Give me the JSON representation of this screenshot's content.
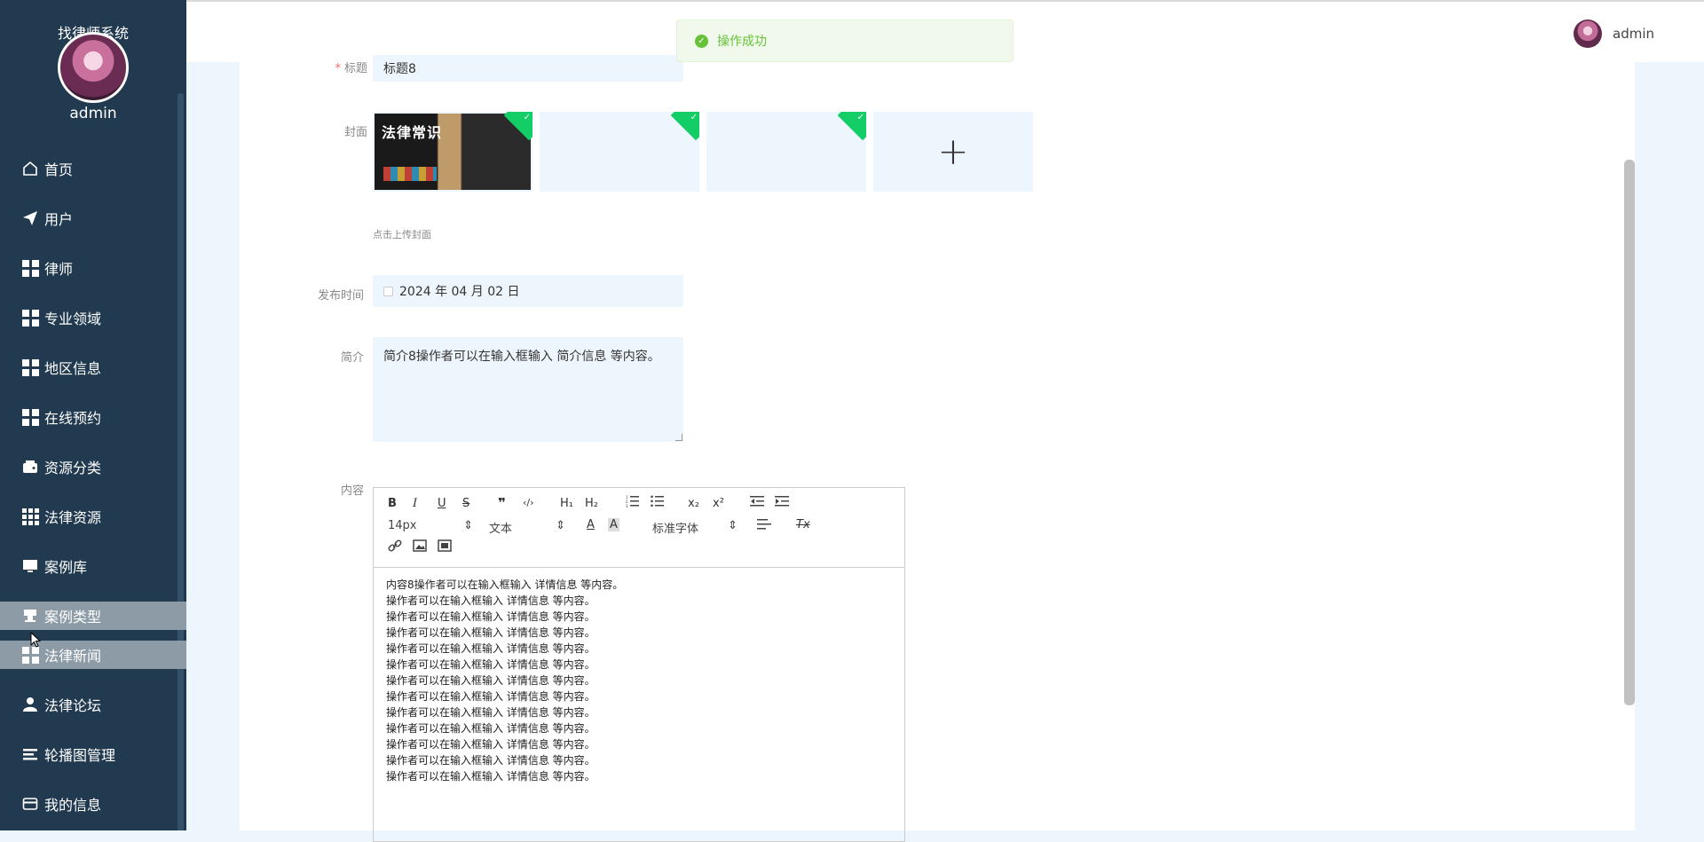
{
  "sidebar": {
    "title": "找律师系统",
    "username": "admin",
    "items": [
      {
        "label": "首页",
        "icon": "home-icon"
      },
      {
        "label": "用户",
        "icon": "send-icon"
      },
      {
        "label": "律师",
        "icon": "grid-icon"
      },
      {
        "label": "专业领域",
        "icon": "grid-icon"
      },
      {
        "label": "地区信息",
        "icon": "grid-icon"
      },
      {
        "label": "在线预约",
        "icon": "grid-icon"
      },
      {
        "label": "资源分类",
        "icon": "wallet-icon"
      },
      {
        "label": "法律资源",
        "icon": "grid9-icon"
      },
      {
        "label": "案例库",
        "icon": "monitor-icon"
      },
      {
        "label": "案例类型",
        "icon": "stamp-icon"
      },
      {
        "label": "法律新闻",
        "icon": "grid-icon"
      },
      {
        "label": "法律论坛",
        "icon": "user-icon"
      },
      {
        "label": "轮播图管理",
        "icon": "list-icon"
      },
      {
        "label": "我的信息",
        "icon": "card-icon"
      }
    ]
  },
  "header": {
    "username": "admin"
  },
  "toast": {
    "message": "操作成功"
  },
  "form": {
    "title_label": "标题",
    "title_value": "标题8",
    "cover_label": "封面",
    "cover_image_text": "法律常识",
    "upload_hint": "点击上传封面",
    "date_label": "发布时间",
    "date_value": "2024 年 04 月 02 日",
    "intro_label": "简介",
    "intro_value": "简介8操作者可以在输入框输入     简介信息       等内容。",
    "content_label": "内容",
    "content_lines": [
      "内容8操作者可以在输入框输入  详情信息  等内容。",
      "操作者可以在输入框输入  详情信息  等内容。",
      "操作者可以在输入框输入  详情信息  等内容。",
      "操作者可以在输入框输入  详情信息  等内容。",
      "操作者可以在输入框输入  详情信息  等内容。",
      "操作者可以在输入框输入  详情信息  等内容。",
      "操作者可以在输入框输入  详情信息  等内容。",
      "操作者可以在输入框输入  详情信息  等内容。",
      "操作者可以在输入框输入  详情信息  等内容。",
      "操作者可以在输入框输入  详情信息  等内容。",
      "操作者可以在输入框输入  详情信息  等内容。",
      "操作者可以在输入框输入  详情信息  等内容。",
      "操作者可以在输入框输入  详情信息  等内容。"
    ]
  },
  "editor": {
    "font_size": "14px",
    "header_select": "文本",
    "font_family": "标准字体",
    "buttons": {
      "bold": "B",
      "italic": "I",
      "underline": "U",
      "strike": "S",
      "quote": "❞",
      "code": "‹/›",
      "h1": "H₁",
      "h2": "H₂",
      "sub": "x₂",
      "sup": "x²",
      "clean": "Tx"
    }
  }
}
